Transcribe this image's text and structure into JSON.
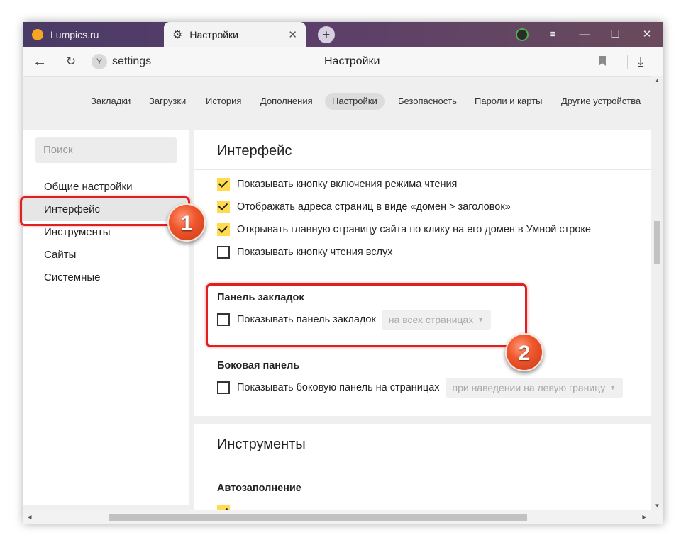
{
  "tabs": [
    {
      "title": "Lumpics.ru"
    },
    {
      "title": "Настройки"
    }
  ],
  "window_controls": {
    "menu": "≡",
    "minimize": "—",
    "maximize": "☐",
    "close": "✕"
  },
  "addressbar": {
    "url": "settings",
    "page_title": "Настройки"
  },
  "topnav": [
    "Закладки",
    "Загрузки",
    "История",
    "Дополнения",
    "Настройки",
    "Безопасность",
    "Пароли и карты",
    "Другие устройства"
  ],
  "topnav_active": "Настройки",
  "sidebar": {
    "search_placeholder": "Поиск",
    "items": [
      "Общие настройки",
      "Интерфейс",
      "Инструменты",
      "Сайты",
      "Системные"
    ],
    "active": "Интерфейс"
  },
  "interface": {
    "title": "Интерфейс",
    "options": [
      {
        "label": "Показывать кнопку включения режима чтения",
        "checked": true
      },
      {
        "label": "Отображать адреса страниц в виде «домен > заголовок»",
        "checked": true
      },
      {
        "label": "Открывать главную страницу сайта по клику на его домен в Умной строке",
        "checked": true
      },
      {
        "label": "Показывать кнопку чтения вслух",
        "checked": false
      }
    ],
    "bookmarks_panel": {
      "title": "Панель закладок",
      "label": "Показывать панель закладок",
      "checked": false,
      "select_value": "на всех страницах"
    },
    "side_panel": {
      "title": "Боковая панель",
      "label": "Показывать боковую панель на страницах",
      "checked": false,
      "select_value": "при наведении на левую границу"
    }
  },
  "tools": {
    "title": "Инструменты",
    "autofill_title": "Автозаполнение"
  },
  "annotations": {
    "badge1": "1",
    "badge2": "2",
    "color": "#e02020"
  },
  "colors": {
    "accent_checkbox": "#ffdb4d",
    "titlebar": "#4a3a66"
  }
}
